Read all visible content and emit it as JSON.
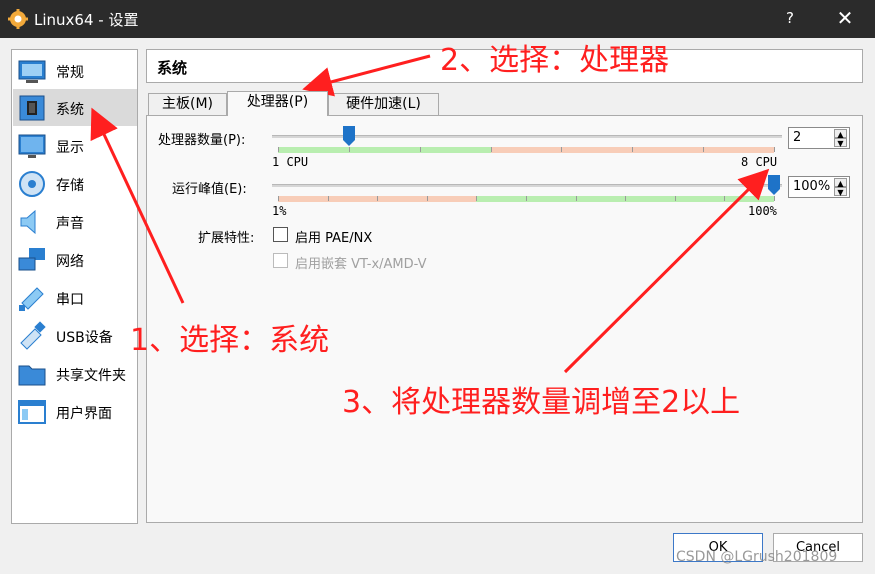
{
  "window": {
    "title": "Linux64 - 设置",
    "help": "?",
    "close": "✕"
  },
  "sidebar": {
    "items": [
      {
        "label": "常规",
        "icon": "general-icon"
      },
      {
        "label": "系统",
        "icon": "system-icon",
        "selected": true
      },
      {
        "label": "显示",
        "icon": "display-icon"
      },
      {
        "label": "存储",
        "icon": "storage-icon"
      },
      {
        "label": "声音",
        "icon": "audio-icon"
      },
      {
        "label": "网络",
        "icon": "network-icon"
      },
      {
        "label": "串口",
        "icon": "serial-port-icon"
      },
      {
        "label": "USB设备",
        "icon": "usb-icon"
      },
      {
        "label": "共享文件夹",
        "icon": "shared-folder-icon"
      },
      {
        "label": "用户界面",
        "icon": "user-interface-icon"
      }
    ]
  },
  "main": {
    "title": "系统",
    "tabs": [
      {
        "label": "主板(M)"
      },
      {
        "label": "处理器(P)",
        "active": true
      },
      {
        "label": "硬件加速(L)"
      }
    ],
    "processor": {
      "count_label": "处理器数量(P):",
      "count_value": "2",
      "count_min_label": "1 CPU",
      "count_max_label": "8 CPU",
      "count_min": 1,
      "count_max": 8,
      "count": 2,
      "exec_cap_label": "运行峰值(E):",
      "exec_cap_value": "100%",
      "exec_cap_min_label": "1%",
      "exec_cap_max_label": "100%",
      "exec_cap_percent": 100,
      "ext_label": "扩展特性:",
      "pae_label": "启用 PAE/NX",
      "pae_checked": false,
      "nested_label": "启用嵌套 VT-x/AMD-V",
      "nested_checked": false,
      "nested_disabled": true
    }
  },
  "buttons": {
    "ok": "OK",
    "cancel": "Cancel"
  },
  "annotations": {
    "step1": "1、选择：系统",
    "step2": "2、选择：处理器",
    "step3": "3、将处理器数量调增至2以上",
    "color": "#ff1f1f"
  },
  "watermark": "CSDN @LGrush201809",
  "colors": {
    "accent": "#1e73c8",
    "safe_zone": "#b9eeb0",
    "warn_zone": "#f8cdb8",
    "titlebar": "#2b2b2b"
  }
}
